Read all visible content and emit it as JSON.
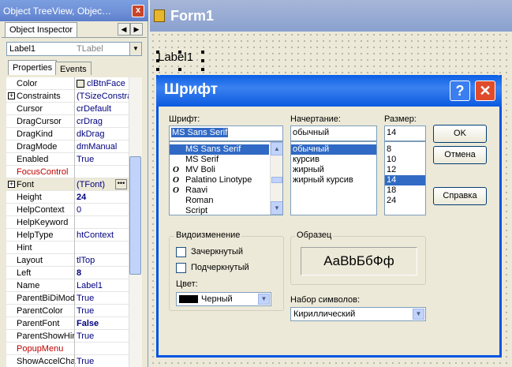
{
  "inspector": {
    "title": "Object TreeView, Objec…",
    "close": "x",
    "tab_label": "Object Inspector",
    "component_name": "Label1",
    "component_type": "TLabel",
    "tabs": [
      "Properties",
      "Events"
    ],
    "rows": [
      {
        "name": "Color",
        "value": "clBtnFace",
        "style": ""
      },
      {
        "name": "Constraints",
        "value": "(TSizeConstra",
        "style": "",
        "expander": "+"
      },
      {
        "name": "Cursor",
        "value": "crDefault",
        "style": ""
      },
      {
        "name": "DragCursor",
        "value": "crDrag",
        "style": ""
      },
      {
        "name": "DragKind",
        "value": "dkDrag",
        "style": ""
      },
      {
        "name": "DragMode",
        "value": "dmManual",
        "style": ""
      },
      {
        "name": "Enabled",
        "value": "True",
        "style": ""
      },
      {
        "name": "FocusControl",
        "value": "",
        "style": "red"
      },
      {
        "name": "Font",
        "value": "(TFont)",
        "style": "",
        "expander": "+",
        "selected": true
      },
      {
        "name": "Height",
        "value": "24",
        "style": "bold"
      },
      {
        "name": "HelpContext",
        "value": "0",
        "style": ""
      },
      {
        "name": "HelpKeyword",
        "value": "",
        "style": ""
      },
      {
        "name": "HelpType",
        "value": "htContext",
        "style": ""
      },
      {
        "name": "Hint",
        "value": "",
        "style": ""
      },
      {
        "name": "Layout",
        "value": "tlTop",
        "style": ""
      },
      {
        "name": "Left",
        "value": "8",
        "style": "bold"
      },
      {
        "name": "Name",
        "value": "Label1",
        "style": ""
      },
      {
        "name": "ParentBiDiMod",
        "value": "True",
        "style": ""
      },
      {
        "name": "ParentColor",
        "value": "True",
        "style": ""
      },
      {
        "name": "ParentFont",
        "value": "False",
        "style": "bold"
      },
      {
        "name": "ParentShowHir",
        "value": "True",
        "style": ""
      },
      {
        "name": "PopupMenu",
        "value": "",
        "style": "red"
      },
      {
        "name": "ShowAccelCha",
        "value": "True",
        "style": ""
      }
    ]
  },
  "form": {
    "title": "Form1",
    "label_caption": "Label1"
  },
  "dialog": {
    "title": "Шрифт",
    "help_glyph": "?",
    "close_glyph": "✕",
    "font_label": "Шрифт:",
    "font_value": "MS Sans Serif",
    "fonts": [
      {
        "name": "MS Sans Serif",
        "selected": true,
        "tt": false
      },
      {
        "name": "MS Serif",
        "selected": false,
        "tt": false
      },
      {
        "name": "MV Boli",
        "selected": false,
        "tt": true
      },
      {
        "name": "Palatino Linotype",
        "selected": false,
        "tt": true
      },
      {
        "name": "Raavi",
        "selected": false,
        "tt": true
      },
      {
        "name": "Roman",
        "selected": false,
        "tt": false
      },
      {
        "name": "Script",
        "selected": false,
        "tt": false
      }
    ],
    "style_label": "Начертание:",
    "style_value": "обычный",
    "styles": [
      {
        "name": "обычный",
        "selected": true
      },
      {
        "name": "курсив",
        "selected": false
      },
      {
        "name": "жирный",
        "selected": false
      },
      {
        "name": "жирный курсив",
        "selected": false
      }
    ],
    "size_label": "Размер:",
    "size_value": "14",
    "sizes": [
      {
        "name": "8",
        "selected": false
      },
      {
        "name": "10",
        "selected": false
      },
      {
        "name": "12",
        "selected": false
      },
      {
        "name": "14",
        "selected": true
      },
      {
        "name": "18",
        "selected": false
      },
      {
        "name": "24",
        "selected": false
      }
    ],
    "ok": "OK",
    "cancel": "Отмена",
    "help": "Справка",
    "effects_label": "Видоизменение",
    "strikeout": "Зачеркнутый",
    "underline": "Подчеркнутый",
    "strikeout_checked": false,
    "underline_checked": false,
    "color_label": "Цвет:",
    "color_value": "Черный",
    "color_swatch": "#000000",
    "sample_label": "Образец",
    "sample_text": "AaBbБбФф",
    "charset_label": "Набор символов:",
    "charset_value": "Кириллический"
  }
}
